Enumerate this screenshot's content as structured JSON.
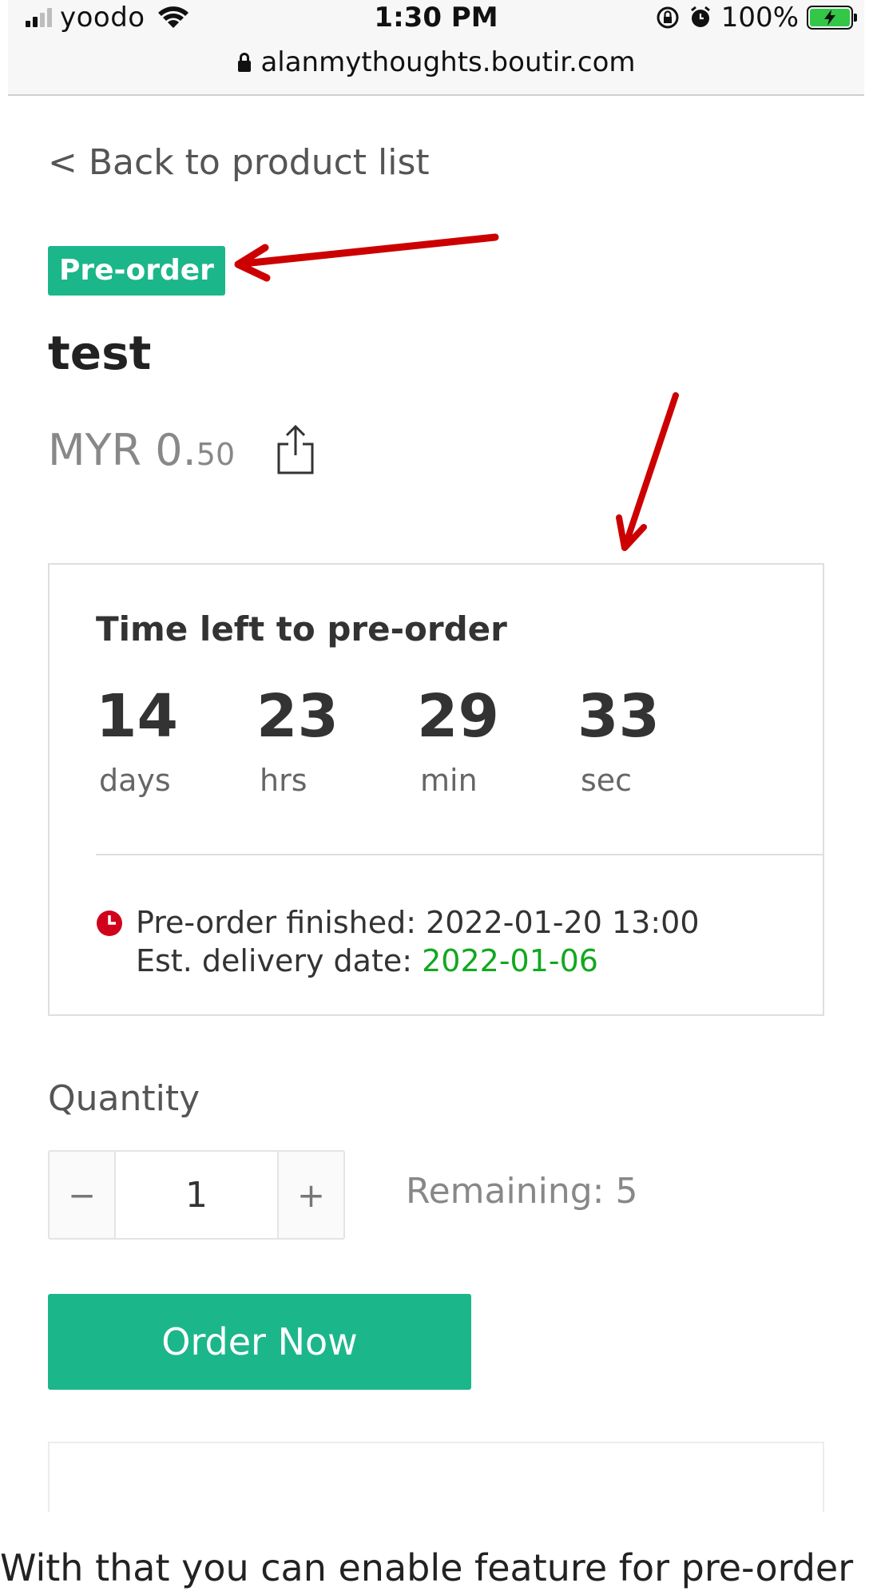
{
  "status_bar": {
    "carrier": "yoodo",
    "time": "1:30 PM",
    "battery": "100%"
  },
  "address_bar": {
    "url": "alanmythoughts.boutir.com"
  },
  "product": {
    "back_link": "< Back to product list",
    "badge": "Pre-order",
    "title": "test",
    "price_main": "MYR 0.",
    "price_cents": "50"
  },
  "countdown": {
    "title": "Time left to pre-order",
    "units": [
      {
        "value": "14",
        "label": "days"
      },
      {
        "value": "23",
        "label": "hrs"
      },
      {
        "value": "29",
        "label": "min"
      },
      {
        "value": "33",
        "label": "sec"
      }
    ],
    "finished_text": "Pre-order finished: 2022-01-20 13:00",
    "delivery_label": "Est. delivery date: ",
    "delivery_date": "2022-01-06"
  },
  "quantity": {
    "label": "Quantity",
    "minus": "−",
    "value": "1",
    "plus": "+",
    "remaining": "Remaining: 5"
  },
  "order_button": "Order Now",
  "caption": "With that you can enable feature for pre-order"
}
